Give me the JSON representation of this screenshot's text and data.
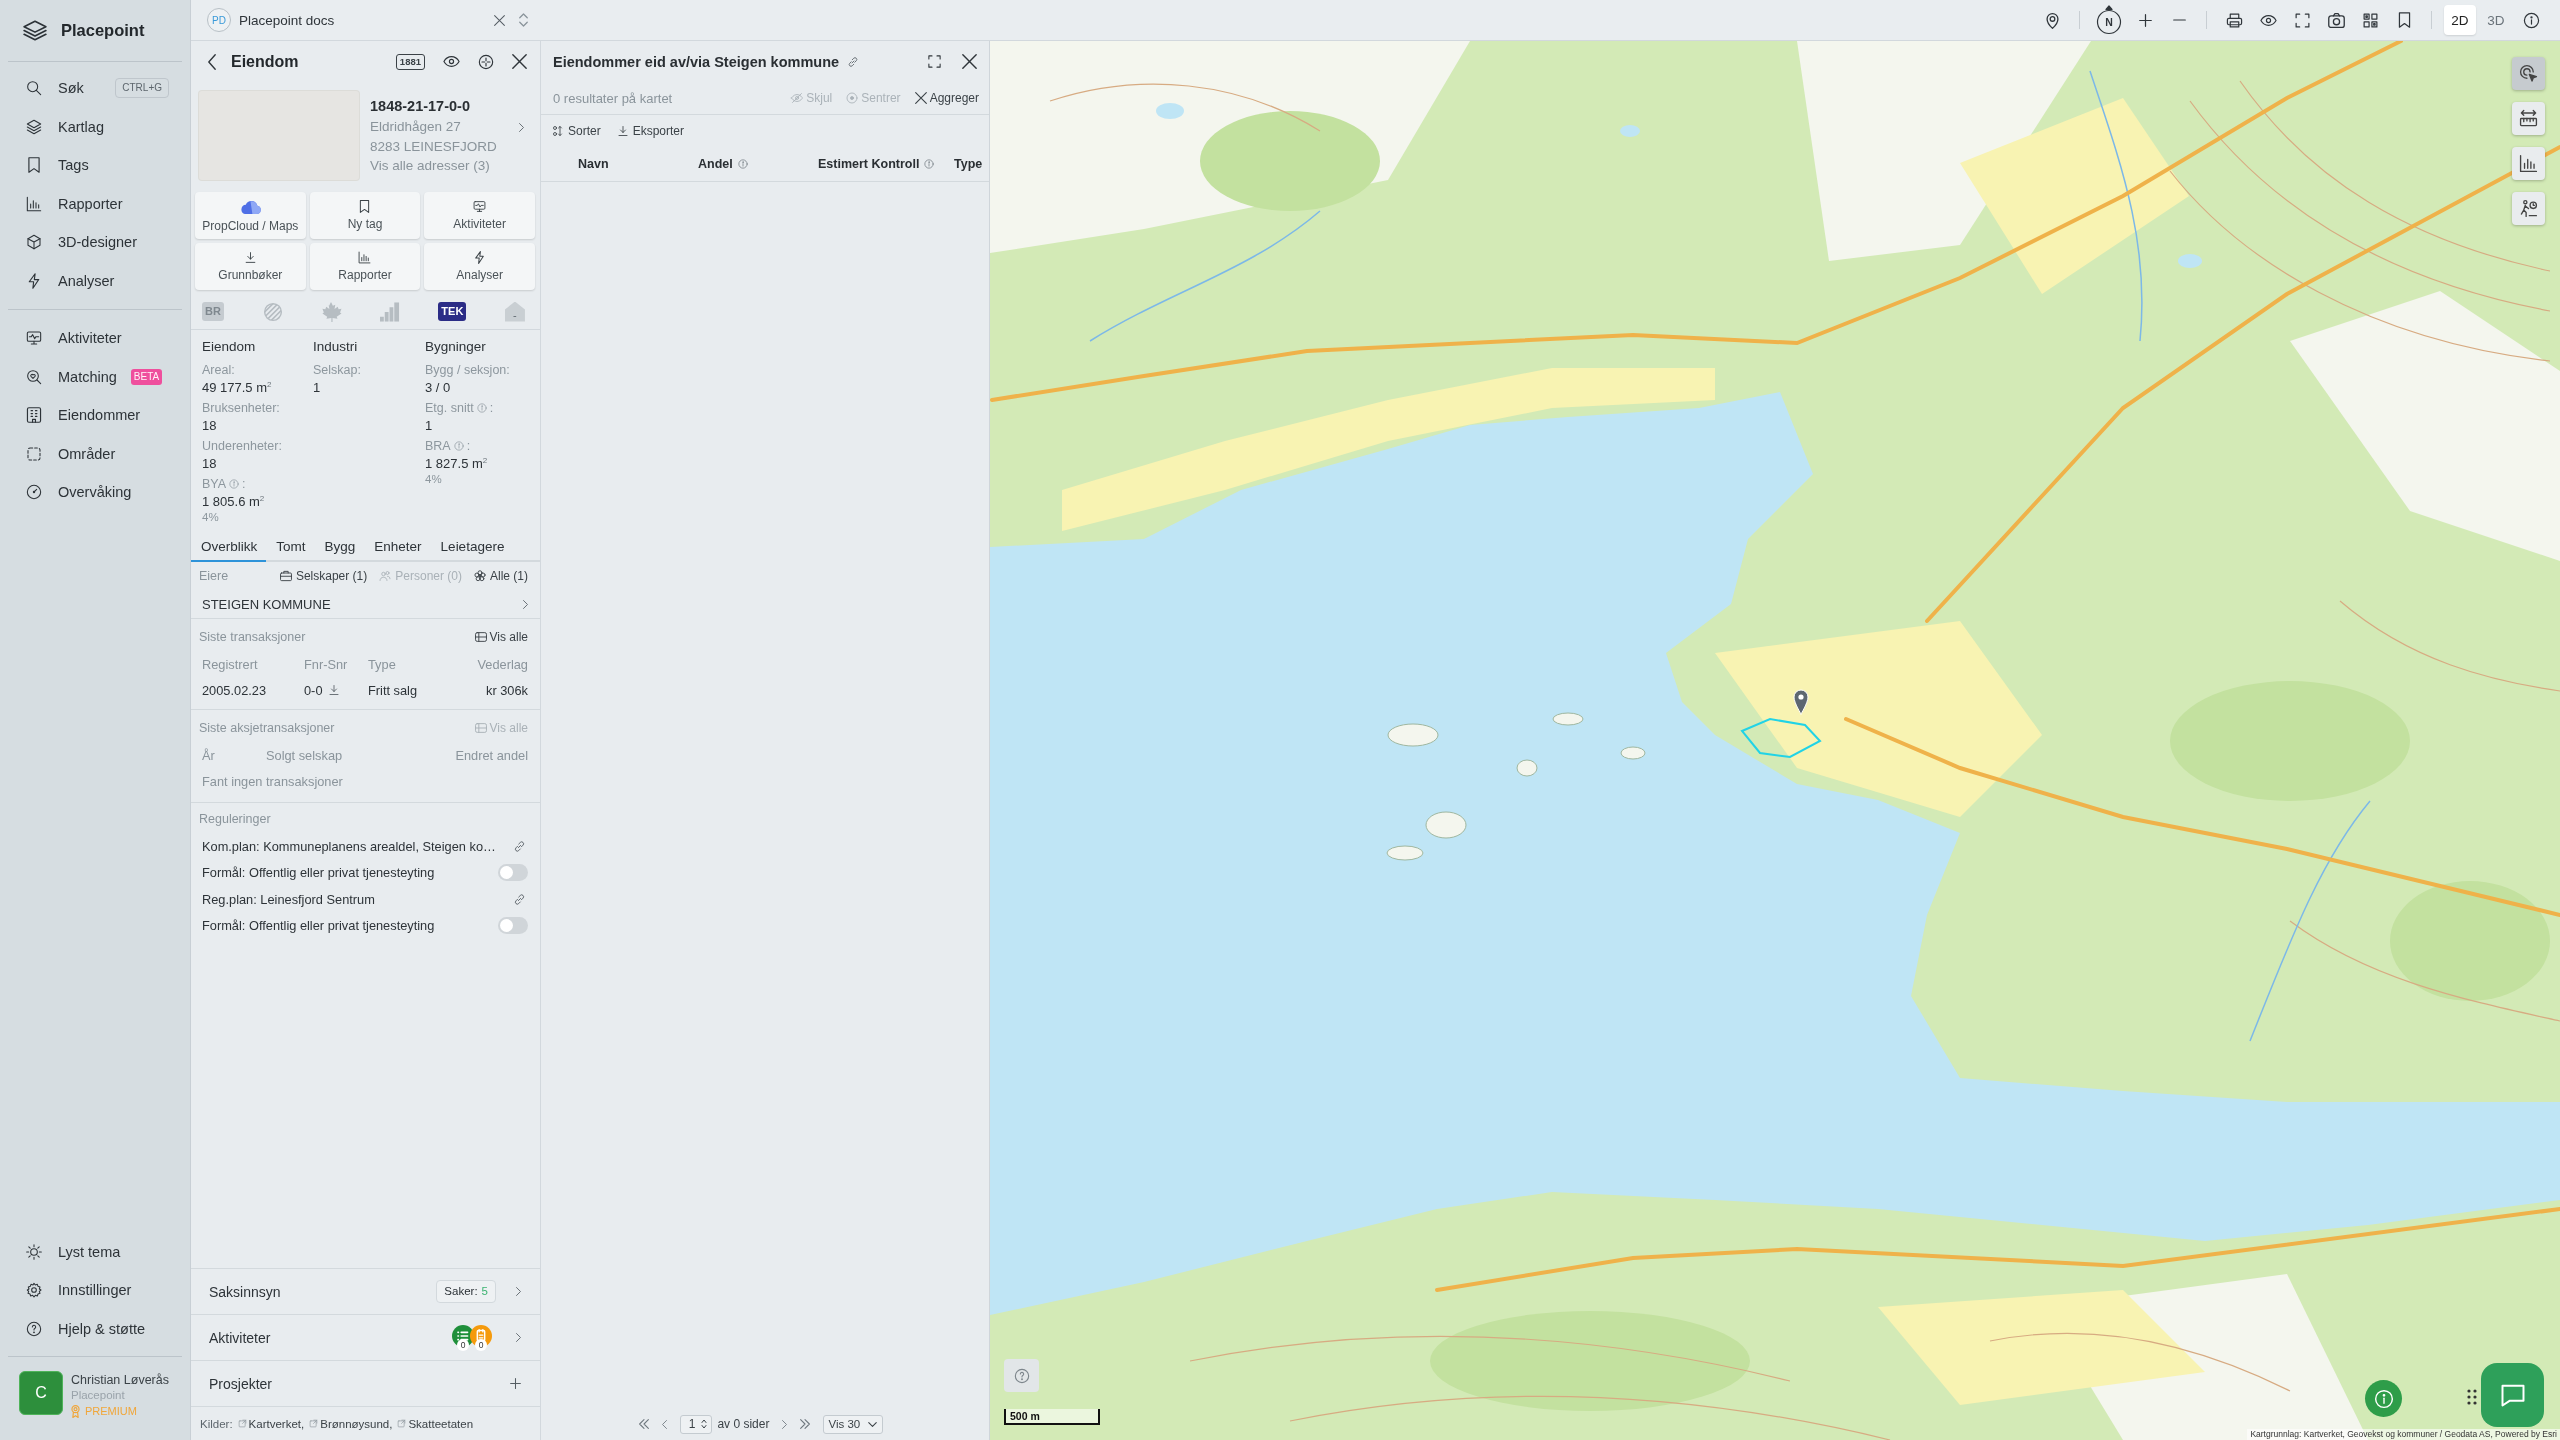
{
  "sidebar": {
    "app_name": "Placepoint",
    "sections": [
      {
        "items": [
          {
            "label": "Søk",
            "shortcut": "CTRL+G"
          },
          {
            "label": "Kartlag"
          },
          {
            "label": "Tags"
          },
          {
            "label": "Rapporter"
          },
          {
            "label": "3D-designer"
          },
          {
            "label": "Analyser"
          }
        ]
      },
      {
        "items": [
          {
            "label": "Aktiviteter"
          },
          {
            "label": "Matching",
            "badge": "BETA"
          },
          {
            "label": "Eiendommer"
          },
          {
            "label": "Områder"
          },
          {
            "label": "Overvåking"
          }
        ]
      }
    ],
    "footer_items": [
      {
        "label": "Lyst tema"
      },
      {
        "label": "Innstillinger"
      },
      {
        "label": "Hjelp & støtte"
      }
    ],
    "user": {
      "initial": "C",
      "name": "Christian Løverås",
      "organization": "Placepoint",
      "plan": "PREMIUM"
    }
  },
  "workspace_tab": {
    "initials": "PD",
    "title": "Placepoint docs"
  },
  "property_panel": {
    "title": "Eiendom",
    "directory_badge": "1881",
    "property": {
      "id": "1848-21-17-0-0",
      "address_lines": [
        "Eldridhågen 27",
        "8283 LEINESFJORD"
      ],
      "more_addresses": "Vis alle adresser (3)"
    },
    "actions": [
      "PropCloud / Maps",
      "Ny tag",
      "Aktiviteter",
      "Grunnbøker",
      "Rapporter",
      "Analyser"
    ],
    "source_icons": [
      {
        "kind": "tag",
        "text": "BR",
        "active": false
      },
      {
        "kind": "icon",
        "active": false
      },
      {
        "kind": "icon",
        "active": false
      },
      {
        "kind": "icon",
        "active": false
      },
      {
        "kind": "tag",
        "text": "TEK",
        "active": true
      },
      {
        "kind": "house",
        "text": "-",
        "active": false
      }
    ],
    "stats": [
      {
        "heading": "Eiendom",
        "fields": [
          {
            "label": "Areal:",
            "value": "49 177.5 m$^{2}$"
          },
          {
            "label": "Bruksenheter:",
            "value": "18"
          },
          {
            "label": "Underenheter:",
            "value": "18"
          },
          {
            "label": "BYA",
            "info": true,
            "suffix": ":",
            "value": "1 805.6 m$^{2}$",
            "share": "4%"
          }
        ]
      },
      {
        "heading": "Industri",
        "fields": [
          {
            "label": "Selskap:",
            "value": "1"
          }
        ]
      },
      {
        "heading": "Bygninger",
        "fields": [
          {
            "label": "Bygg / seksjon:",
            "value": "3 / 0"
          },
          {
            "label": "Etg. snitt",
            "info": true,
            "suffix": ":",
            "value": "1"
          },
          {
            "label": "BRA",
            "info": true,
            "suffix": ":",
            "value": "1 827.5 m$^{2}$",
            "share": "4%"
          }
        ]
      }
    ],
    "tabs": [
      {
        "label": "Overblikk",
        "selected": true
      },
      {
        "label": "Tomt",
        "selected": false
      },
      {
        "label": "Bygg",
        "selected": false
      },
      {
        "label": "Enheter",
        "selected": false
      },
      {
        "label": "Leietagere",
        "selected": false
      }
    ],
    "owners": {
      "title": "Eiere",
      "filters": [
        {
          "label": "Selskaper (1)",
          "disabled": false
        },
        {
          "label": "Personer (0)",
          "disabled": true
        },
        {
          "label": "Alle (1)",
          "disabled": false
        }
      ],
      "rows": [
        "STEIGEN KOMMUNE"
      ]
    },
    "transactions": {
      "title": "Siste transaksjoner",
      "link": {
        "label": "Vis alle",
        "disabled": false
      },
      "columns": [
        "Registrert",
        "Fnr-Snr",
        "Type",
        "Vederlag"
      ],
      "rows": [
        [
          "2005.02.23",
          "0-0",
          "Fritt salg",
          "kr 306k"
        ]
      ]
    },
    "share_transactions": {
      "title": "Siste aksjetransaksjoner",
      "link": {
        "label": "Vis alle",
        "disabled": true
      },
      "columns": [
        "År",
        "Solgt selskap",
        "Endret andel"
      ],
      "empty_text": "Fant ingen transaksjoner"
    },
    "regulations": {
      "title": "Reguleringer",
      "rows": [
        {
          "kind": "link",
          "text": "Kom.plan: Kommuneplanens arealdel, Steigen ko…"
        },
        {
          "kind": "toggle",
          "text": "Formål: Offentlig eller privat tjenesteyting",
          "on": false
        },
        {
          "kind": "link",
          "text": "Reg.plan: Leinesfjord Sentrum"
        },
        {
          "kind": "toggle",
          "text": "Formål: Offentlig eller privat tjenesteyting",
          "on": false
        }
      ]
    },
    "sections": [
      {
        "kind": "badge",
        "label": "Saksinnsyn",
        "badge_label": "Saker:",
        "badge_value": "5"
      },
      {
        "kind": "activities",
        "label": "Aktiviteter",
        "counts": [
          {
            "count": "0",
            "color": "#1f8f3a"
          },
          {
            "count": "0",
            "color": "#f59a0c"
          }
        ]
      },
      {
        "kind": "add",
        "label": "Prosjekter"
      }
    ],
    "sources": {
      "label": "Kilder:",
      "links": [
        "Kartverket,",
        "Brønnøysund,",
        "Skatteetaten"
      ]
    }
  },
  "results_panel": {
    "title": "Eiendommer eid av/via Steigen kommune",
    "result_count": "0 resultater på kartet",
    "actions": [
      {
        "label": "Skjul",
        "disabled": true
      },
      {
        "label": "Sentrer",
        "disabled": true
      },
      {
        "label": "Aggreger",
        "disabled": false
      }
    ],
    "tools": [
      "Sorter",
      "Eksporter"
    ],
    "columns": [
      {
        "label": "Navn",
        "info": false
      },
      {
        "label": "Andel",
        "info": true
      },
      {
        "label": "Estimert Kontroll",
        "info": true
      },
      {
        "label": "Type",
        "info": false
      }
    ],
    "pagination": {
      "page": "1",
      "page_count": "av 0 sider",
      "page_size": "Vis 30"
    }
  },
  "map": {
    "compass": "N",
    "view_modes": [
      {
        "label": "2D",
        "selected": true
      },
      {
        "label": "3D",
        "selected": false
      }
    ],
    "tools": [
      {
        "selected": true
      },
      {
        "selected": false
      },
      {
        "selected": false
      },
      {
        "selected": false
      }
    ],
    "scale": "500 m",
    "attribution": "Kartgrunnlag: Kartverket, Geovekst og kommuner / Geodata AS, Powered by Esri"
  }
}
